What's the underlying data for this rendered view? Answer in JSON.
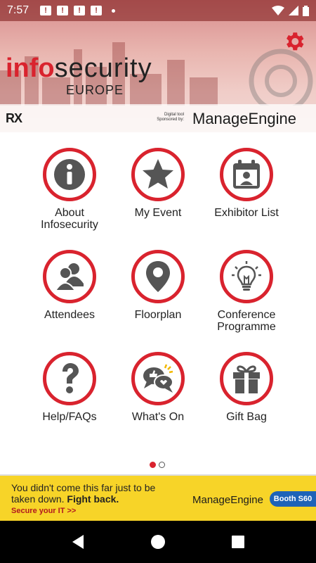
{
  "status_bar": {
    "time": "7:57",
    "notification_count": 4
  },
  "header": {
    "logo_info": "info",
    "logo_security": "security",
    "logo_europe": "EUROPE",
    "organiser": "RX",
    "sponsor_caption": "Digital tool Sponsored by:",
    "sponsor_name": "ManageEngine"
  },
  "tiles": [
    {
      "label": "About\nInfosecurity",
      "icon": "info-icon"
    },
    {
      "label": "My Event",
      "icon": "star-icon"
    },
    {
      "label": "Exhibitor List",
      "icon": "calendar-person-icon"
    },
    {
      "label": "Attendees",
      "icon": "people-icon"
    },
    {
      "label": "Floorplan",
      "icon": "map-pin-icon"
    },
    {
      "label": "Conference\nProgramme",
      "icon": "lightbulb-icon"
    },
    {
      "label": "Help/FAQs",
      "icon": "question-icon"
    },
    {
      "label": "What's On",
      "icon": "chat-bubbles-icon"
    },
    {
      "label": "Gift Bag",
      "icon": "gift-icon"
    }
  ],
  "pager": {
    "pages": 2,
    "active": 1
  },
  "ad": {
    "line1": "You didn't come this far just to be",
    "line2_plain": "taken down. ",
    "line2_bold": "Fight back.",
    "cta": "Secure your IT  >>",
    "brand": "ManageEngine",
    "booth": "Booth S60"
  },
  "colors": {
    "accent": "#d9232e",
    "ad_background": "#f7d428",
    "booth_blue": "#1e63b8"
  }
}
